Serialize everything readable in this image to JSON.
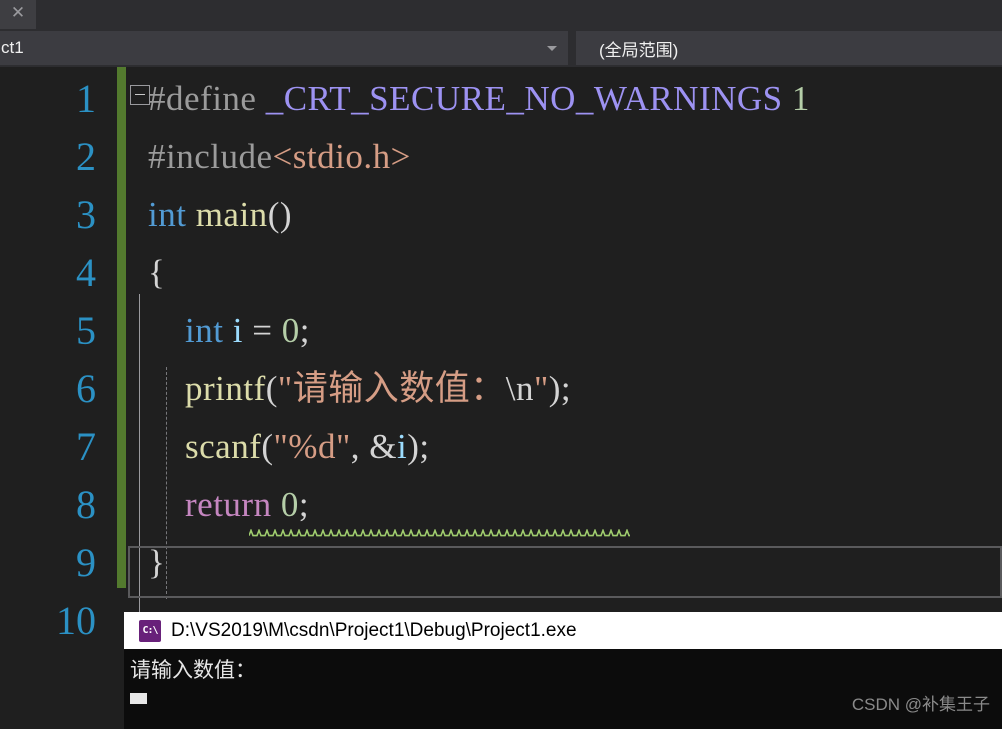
{
  "window": {
    "tab": {
      "label": "ct1",
      "close_icon": "close-icon"
    },
    "navbar": {
      "scope_selector_value": "ct1",
      "scope_selector_arrow": "chevron-down-icon",
      "member_selector_value": "(全局范围)"
    }
  },
  "editor": {
    "line_numbers": [
      "1",
      "2",
      "3",
      "4",
      "5",
      "6",
      "7",
      "8",
      "9",
      "10"
    ],
    "collapse_icon": "collapse-minus-icon",
    "lines": [
      {
        "n": "1",
        "tokens": [
          {
            "t": "#define ",
            "c": "t-pp"
          },
          {
            "t": "_CRT_SECURE_NO_WARNINGS",
            "c": "t-macro"
          },
          {
            "t": " 1",
            "c": "t-num"
          }
        ]
      },
      {
        "n": "2",
        "tokens": [
          {
            "t": "#include",
            "c": "t-pp"
          },
          {
            "t": "<stdio.h>",
            "c": "t-str"
          }
        ]
      },
      {
        "n": "3",
        "tokens": [
          {
            "t": "int",
            "c": "t-kw"
          },
          {
            "t": " ",
            "c": "t-plain"
          },
          {
            "t": "main",
            "c": "t-fn"
          },
          {
            "t": "()",
            "c": "t-plain"
          }
        ]
      },
      {
        "n": "4",
        "tokens": [
          {
            "t": "{",
            "c": "t-brace"
          }
        ]
      },
      {
        "n": "5",
        "tokens": [
          {
            "t": "    ",
            "c": "t-plain"
          },
          {
            "t": "int",
            "c": "t-kw"
          },
          {
            "t": " ",
            "c": "t-plain"
          },
          {
            "t": "i",
            "c": "t-var"
          },
          {
            "t": " = ",
            "c": "t-plain"
          },
          {
            "t": "0",
            "c": "t-num"
          },
          {
            "t": ";",
            "c": "t-plain"
          }
        ]
      },
      {
        "n": "6",
        "tokens": [
          {
            "t": "    ",
            "c": "t-plain"
          },
          {
            "t": "printf",
            "c": "t-fn"
          },
          {
            "t": "(",
            "c": "t-plain"
          },
          {
            "t": "\"请输入数值：",
            "c": "t-str"
          },
          {
            "t": "\\n",
            "c": "t-plain"
          },
          {
            "t": "\"",
            "c": "t-str"
          },
          {
            "t": ");",
            "c": "t-plain"
          }
        ]
      },
      {
        "n": "7",
        "tokens": [
          {
            "t": "    ",
            "c": "t-plain"
          },
          {
            "t": "scanf",
            "c": "t-fn"
          },
          {
            "t": "(",
            "c": "t-plain"
          },
          {
            "t": "\"%d\"",
            "c": "t-str"
          },
          {
            "t": ", &",
            "c": "t-plain"
          },
          {
            "t": "i",
            "c": "t-var"
          },
          {
            "t": ");",
            "c": "t-plain"
          }
        ]
      },
      {
        "n": "8",
        "tokens": [
          {
            "t": "    ",
            "c": "t-plain"
          },
          {
            "t": "return",
            "c": "t-ret"
          },
          {
            "t": " ",
            "c": "t-plain"
          },
          {
            "t": "0",
            "c": "t-num"
          },
          {
            "t": ";",
            "c": "t-plain"
          }
        ]
      },
      {
        "n": "9",
        "tokens": [
          {
            "t": "}",
            "c": "t-brace"
          }
        ]
      },
      {
        "n": "10",
        "tokens": []
      }
    ],
    "warning_squiggle_line": "7",
    "current_line": "8",
    "change_bar_color": "#537a2e",
    "squiggle_color": "#9fcc6e"
  },
  "console": {
    "title": "D:\\VS2019\\M\\csdn\\Project1\\Debug\\Project1.exe",
    "icon": "cmd-console-icon",
    "icon_label": "C:\\",
    "output": "请输入数值：",
    "cursor": "block-cursor"
  },
  "watermark": {
    "text": "CSDN @补集王子"
  }
}
